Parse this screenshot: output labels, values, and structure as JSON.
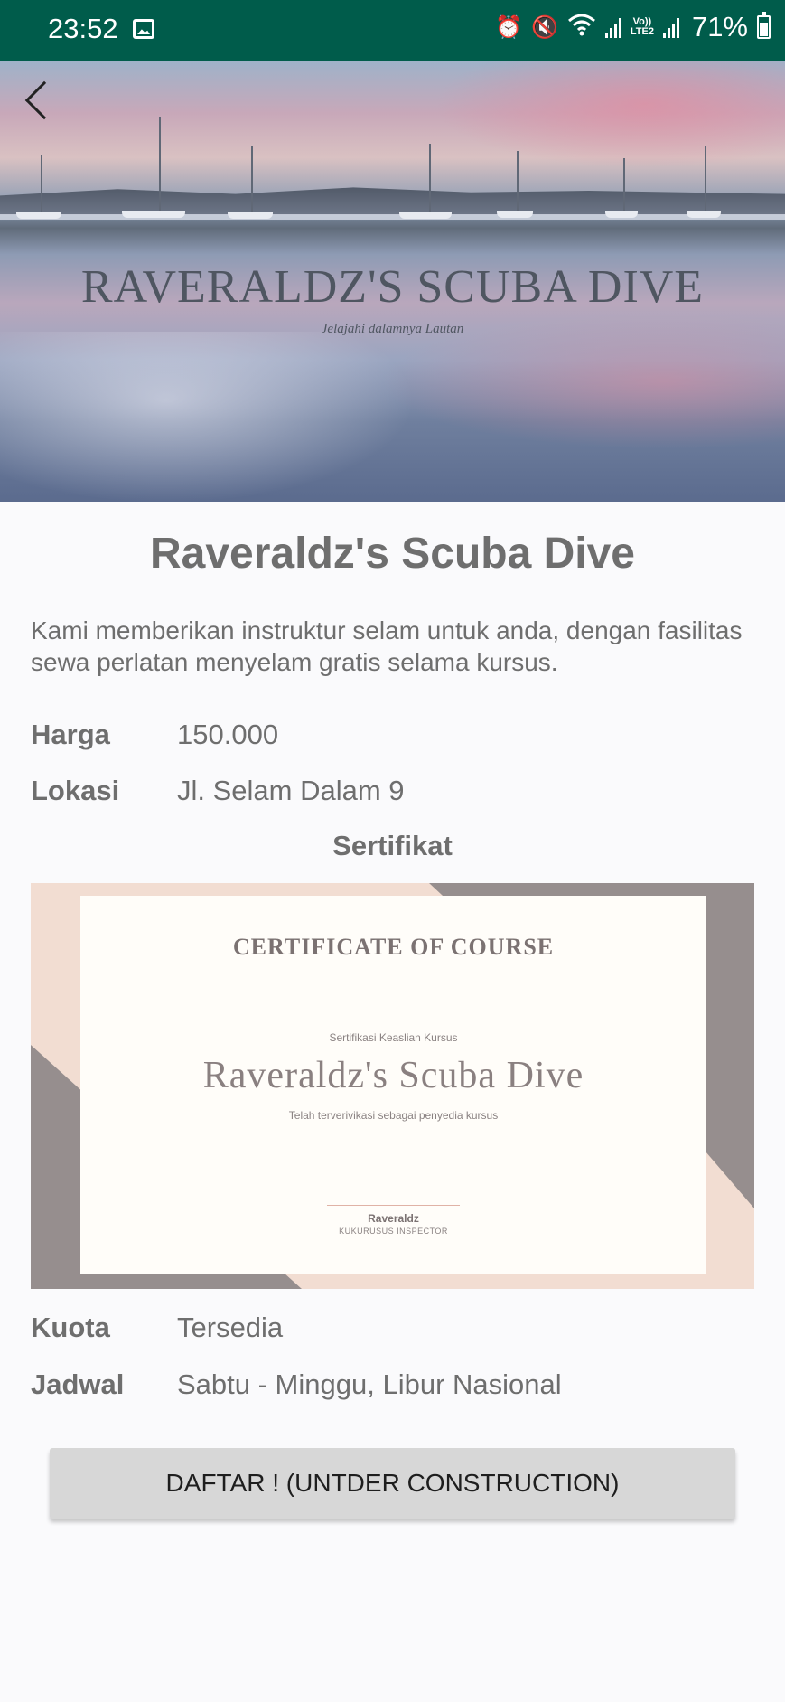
{
  "status_bar": {
    "time": "23:52",
    "network_label_top": "Vo))",
    "network_label_bottom": "LTE2",
    "battery_percent": "71%",
    "icons": [
      "gallery-icon",
      "alarm-icon",
      "mute-icon",
      "wifi-icon",
      "signal-icon",
      "battery-icon"
    ]
  },
  "hero": {
    "banner_title": "RAVERALDZ'S SCUBA DIVE",
    "banner_subtitle": "Jelajahi dalamnya Lautan"
  },
  "detail": {
    "title": "Raveraldz's Scuba Dive",
    "description": "Kami memberikan instruktur selam untuk anda, dengan fasilitas sewa perlatan menyelam gratis selama kursus.",
    "price_label": "Harga",
    "price_value": "150.000",
    "location_label": "Lokasi",
    "location_value": "Jl. Selam Dalam 9",
    "certificate_section": "Sertifikat",
    "quota_label": "Kuota",
    "quota_value": "Tersedia",
    "schedule_label": "Jadwal",
    "schedule_value": "Sabtu - Minggu, Libur Nasional"
  },
  "certificate": {
    "heading": "CERTIFICATE OF COURSE",
    "caption_top": "Sertifikasi Keaslian Kursus",
    "name": "Raveraldz's Scuba Dive",
    "caption_bottom": "Telah terverivikasi sebagai penyedia kursus",
    "signer": "Raveraldz",
    "signer_role": "KUKURUSUS INSPECTOR",
    "colors": {
      "background": "#f2ddd2",
      "accent": "#968e8e",
      "paper": "#fffdf9"
    }
  },
  "actions": {
    "register_label": "DAFTAR ! (UNTDER CONSTRUCTION)"
  },
  "theme": {
    "status_bar_color": "#005c4b",
    "text_color": "#6e6e6e",
    "button_color": "#d7d7d7"
  }
}
